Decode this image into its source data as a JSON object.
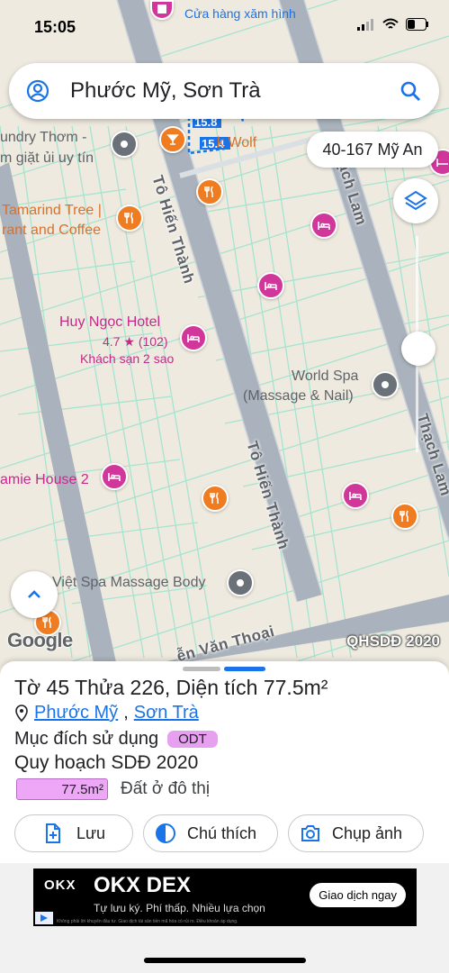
{
  "status_bar": {
    "time": "15:05"
  },
  "search": {
    "text": "Phước Mỹ, Sơn Trà"
  },
  "map": {
    "address_chip": "40-167 Mỹ An",
    "streets": {
      "to_hien_thanh_1": "Tô Hiến Thành",
      "to_hien_thanh_2": "Tô Hiến Thành",
      "bach_lam": "ạch Lam",
      "thach_lam": "Thạch Lam",
      "van_thoai": "ễn Văn Thoại"
    },
    "route_labels": [
      "15.8",
      "15.4"
    ],
    "pois": {
      "tattoo": "Cửa hàng xăm hình",
      "laundry_1": "undry Thơm -",
      "laundry_2": "m giặt ủi uy tín",
      "wolf": "k Wolf",
      "tamarind_1": "Tamarind Tree |",
      "tamarind_2": "rant and Coffee",
      "huy_ngoc": "Huy Ngọc Hotel",
      "huy_ngoc_rating": "4.7",
      "huy_ngoc_count": "(102)",
      "huy_ngoc_type": "Khách sạn 2 sao",
      "world_spa_1": "World Spa",
      "world_spa_2": "(Massage & Nail)",
      "amie_house": "amie House 2",
      "viet_spa": "Việt Spa Massage Body"
    },
    "google_logo": "Google",
    "qh_label": "QHSDĐ 2020"
  },
  "sheet": {
    "title_prefix": "Tờ ",
    "to_number": "45",
    "title_mid": " Thửa ",
    "thua_number": "226",
    "title_suffix": ", Diện tích 77.5m²",
    "ward": "Phước Mỹ",
    "district": "Sơn Trà",
    "purpose_label": "Mục đích sử dụng",
    "purpose_code": "ODT",
    "plan_label": "Quy hoạch SDĐ 2020",
    "plan_area": "77.5m²",
    "plan_landuse": "Đất ở đô thị",
    "landuse_color": "#eea7f7",
    "actions": {
      "save": "Lưu",
      "legend": "Chú thích",
      "photo": "Chụp ảnh"
    }
  },
  "ad": {
    "logo": "OKX",
    "brand": "OKX DEX",
    "tagline": "Tự lưu ký. Phí thấp. Nhiều lựa chọn",
    "cta": "Giao dịch ngay",
    "fine_print": "Không phải lời khuyên đầu tư. Giao dịch tài sản tiền mã hóa có rủi ro. Điều khoản áp dụng."
  },
  "colors": {
    "accent": "#1a73e8",
    "poi_pink": "#d1379b",
    "poi_orange": "#f07c22",
    "road": "#a9b3bd"
  }
}
